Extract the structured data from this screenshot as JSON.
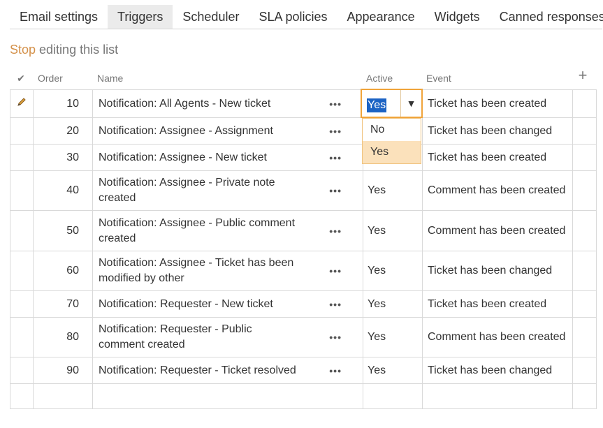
{
  "tabs": [
    {
      "label": "Email settings"
    },
    {
      "label": "Triggers",
      "active": true
    },
    {
      "label": "Scheduler"
    },
    {
      "label": "SLA policies"
    },
    {
      "label": "Appearance"
    },
    {
      "label": "Widgets"
    },
    {
      "label": "Canned responses"
    }
  ],
  "edit_link": {
    "link": "Stop",
    "rest": " editing this list"
  },
  "columns": {
    "check": "✔",
    "order": "Order",
    "name": "Name",
    "active": "Active",
    "event": "Event",
    "add": "+"
  },
  "rows": [
    {
      "order": "10",
      "name": "Notification: All Agents - New ticket",
      "active": "Yes",
      "event": "Ticket has been created"
    },
    {
      "order": "20",
      "name": "Notification: Assignee - Assignment",
      "active": "",
      "event": "Ticket has been changed"
    },
    {
      "order": "30",
      "name": "Notification: Assignee - New ticket",
      "active": "",
      "event": "Ticket has been created"
    },
    {
      "order": "40",
      "name": "Notification: Assignee - Private note created",
      "active": "Yes",
      "event": "Comment has been created"
    },
    {
      "order": "50",
      "name": "Notification: Assignee - Public comment created",
      "active": "Yes",
      "event": "Comment has been created"
    },
    {
      "order": "60",
      "name": "Notification: Assignee - Ticket has been modified by other",
      "active": "Yes",
      "event": "Ticket has been changed"
    },
    {
      "order": "70",
      "name": "Notification: Requester - New ticket",
      "active": "Yes",
      "event": "Ticket has been created"
    },
    {
      "order": "80",
      "name": "Notification: Requester - Public comment created",
      "active": "Yes",
      "event": "Comment has been created"
    },
    {
      "order": "90",
      "name": "Notification: Requester - Ticket resolved",
      "active": "Yes",
      "event": "Ticket has been changed"
    },
    {
      "order": "",
      "name": "",
      "active": "",
      "event": ""
    }
  ],
  "row_menu_glyph": "•••",
  "active_dropdown": {
    "value": "Yes",
    "arrow": "▼",
    "options": [
      "No",
      "Yes"
    ],
    "highlighted": "Yes"
  },
  "colors": {
    "accent": "#f0a43a",
    "link": "#d4914a",
    "selection": "#1c63c4",
    "option_highlight": "#fbe1bb"
  }
}
